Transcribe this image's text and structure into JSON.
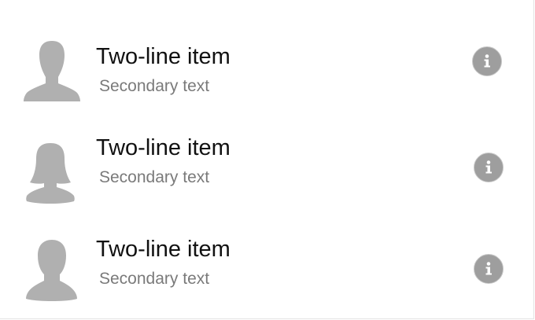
{
  "list": {
    "items": [
      {
        "primary": "Two-line item",
        "secondary": "Secondary text",
        "avatar": "male-person-icon",
        "action_icon": "info-icon"
      },
      {
        "primary": "Two-line item",
        "secondary": "Secondary text",
        "avatar": "female-person-icon",
        "action_icon": "info-icon"
      },
      {
        "primary": "Two-line item",
        "secondary": "Secondary text",
        "avatar": "male-person-icon",
        "action_icon": "info-icon"
      }
    ]
  },
  "colors": {
    "avatar": "#b0b0b0",
    "info_button": "#9e9e9e",
    "primary_text": "#111111",
    "secondary_text": "#7a7a7a"
  }
}
